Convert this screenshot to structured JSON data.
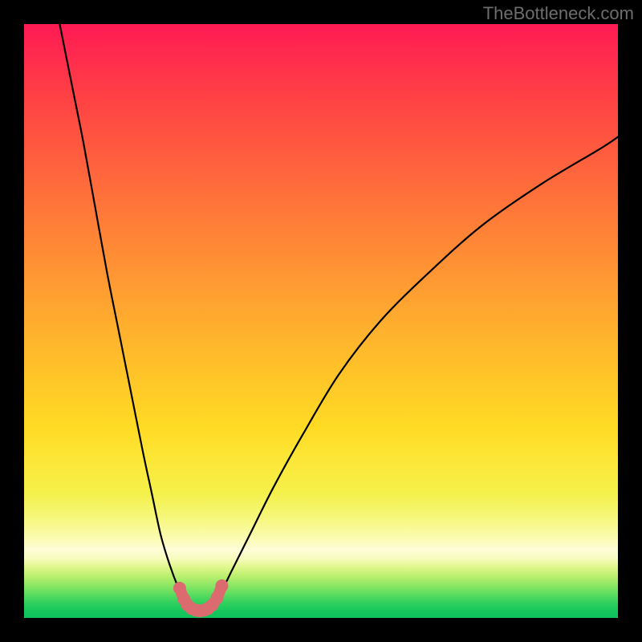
{
  "watermark": {
    "text": "TheBottleneck.com"
  },
  "chart_data": {
    "type": "line",
    "title": "",
    "xlabel": "",
    "ylabel": "",
    "xlim": [
      0,
      100
    ],
    "ylim": [
      0,
      100
    ],
    "grid": false,
    "legend": false,
    "gradient_stops": [
      {
        "pos": 0,
        "color": "#ff1a52"
      },
      {
        "pos": 20,
        "color": "#ff5740"
      },
      {
        "pos": 44,
        "color": "#ff9b32"
      },
      {
        "pos": 68,
        "color": "#ffdb24"
      },
      {
        "pos": 86,
        "color": "#fbfbb0"
      },
      {
        "pos": 93,
        "color": "#b9ef6e"
      },
      {
        "pos": 100,
        "color": "#0fc25c"
      }
    ],
    "series": [
      {
        "name": "bottleneck-curve-left",
        "stroke": "#000000",
        "x": [
          6,
          8,
          10,
          12,
          14,
          16,
          18,
          20,
          21.5,
          23,
          24.5,
          26,
          27,
          27.8
        ],
        "y": [
          100,
          90,
          80,
          69,
          58,
          48,
          38,
          28,
          21,
          14,
          9,
          5,
          3,
          2
        ]
      },
      {
        "name": "bottleneck-curve-right",
        "stroke": "#000000",
        "x": [
          31.5,
          33,
          35,
          38,
          42,
          47,
          53,
          60,
          68,
          77,
          87,
          97,
          100
        ],
        "y": [
          2,
          4,
          8,
          14,
          22,
          31,
          41,
          50,
          58,
          66,
          73,
          79,
          81
        ]
      },
      {
        "name": "optimal-dots",
        "stroke": "#db6b6e",
        "marker": "circle",
        "x": [
          26.2,
          26.9,
          27.5,
          28.2,
          28.9,
          29.6,
          30.3,
          31.0,
          31.7,
          32.5,
          33.3
        ],
        "y": [
          5.0,
          3.2,
          2.2,
          1.6,
          1.3,
          1.2,
          1.3,
          1.6,
          2.2,
          3.4,
          5.4
        ]
      }
    ],
    "optimal_x": 29.6
  }
}
